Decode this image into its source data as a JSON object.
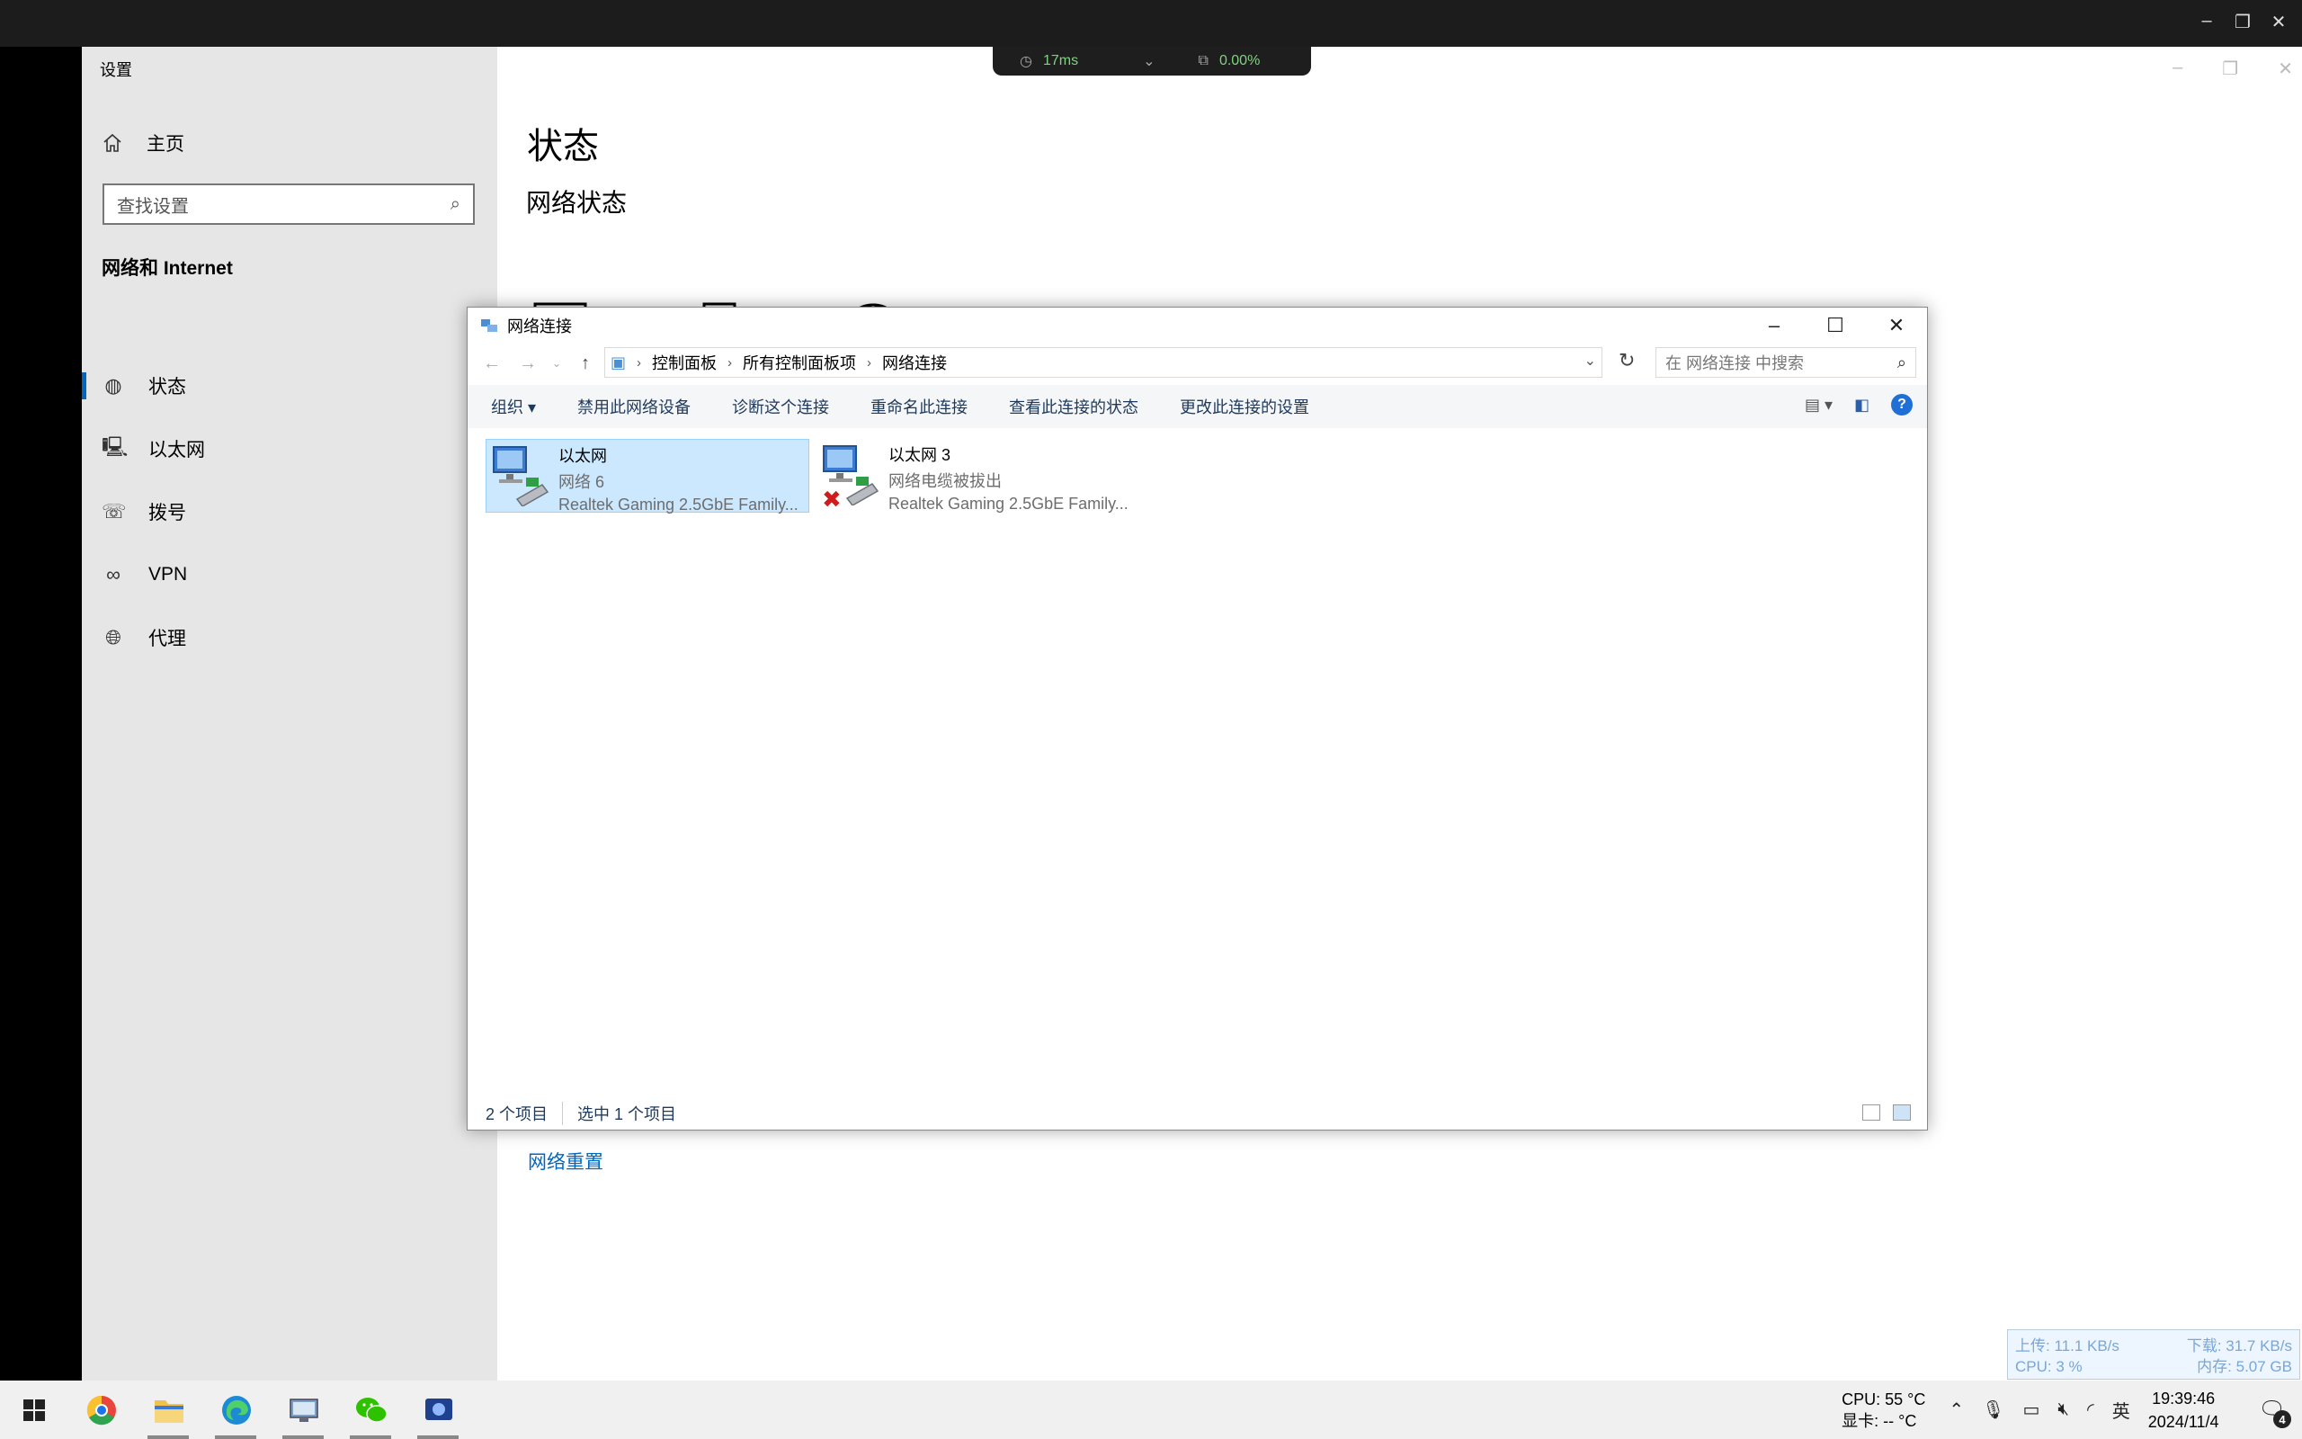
{
  "remote_bar": {
    "latency": "17ms",
    "loss": "0.00%"
  },
  "settings": {
    "window_title": "设置",
    "home_label": "主页",
    "search_placeholder": "查找设置",
    "section_heading": "网络和 Internet",
    "nav_items": [
      {
        "label": "状态",
        "icon": "globe-status-icon"
      },
      {
        "label": "以太网",
        "icon": "ethernet-icon"
      },
      {
        "label": "拨号",
        "icon": "dialup-icon"
      },
      {
        "label": "VPN",
        "icon": "vpn-icon"
      },
      {
        "label": "代理",
        "icon": "proxy-icon"
      }
    ],
    "page_title": "状态",
    "page_subtitle": "网络状态",
    "reset_link": "网络重置"
  },
  "dialog": {
    "title": "网络连接",
    "breadcrumb": [
      "控制面板",
      "所有控制面板项",
      "网络连接"
    ],
    "search_placeholder": "在 网络连接 中搜索",
    "toolbar": [
      "组织 ▾",
      "禁用此网络设备",
      "诊断这个连接",
      "重命名此连接",
      "查看此连接的状态",
      "更改此连接的设置"
    ],
    "connections": [
      {
        "name": "以太网",
        "network": "网络 6",
        "adapter": "Realtek Gaming 2.5GbE Family...",
        "selected": true,
        "disconnected": false
      },
      {
        "name": "以太网 3",
        "network": "网络电缆被拔出",
        "adapter": "Realtek Gaming 2.5GbE Family...",
        "selected": false,
        "disconnected": true
      }
    ],
    "status_count": "2 个项目",
    "status_selected": "选中 1 个项目"
  },
  "net_widget": {
    "upload": "上传: 11.1 KB/s",
    "download": "下载: 31.7 KB/s",
    "cpu": "CPU: 3 %",
    "memory": "内存: 5.07 GB"
  },
  "taskbar": {
    "apps": [
      "windows-start",
      "chrome",
      "file-explorer",
      "edge",
      "remote-desktop",
      "wechat",
      "vpn-client"
    ],
    "cpu_temp": "CPU: 55 °C",
    "gpu_temp": "显卡: -- °C",
    "ime": "英",
    "time": "19:39:46",
    "date": "2024/11/4",
    "notifications": "4"
  },
  "colors": {
    "accent": "#0067c0",
    "selection": "#cce8ff",
    "sidebar": "#e6e6e6"
  }
}
